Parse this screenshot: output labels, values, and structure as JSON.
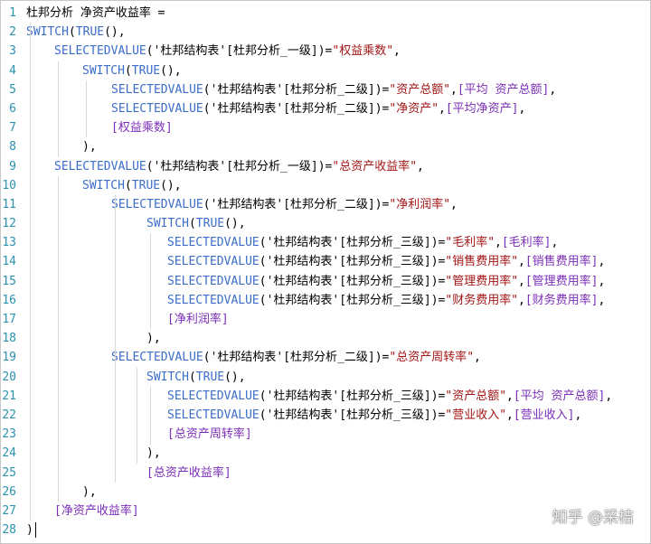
{
  "editor": {
    "lines": [
      {
        "n": "1",
        "indent": 0,
        "tokens": [
          {
            "t": "pl",
            "v": "杜邦分析 净资产收益率 ="
          }
        ]
      },
      {
        "n": "2",
        "indent": 0,
        "tokens": [
          {
            "t": "fn",
            "v": "SWITCH"
          },
          {
            "t": "pl",
            "v": "("
          },
          {
            "t": "fn",
            "v": "TRUE"
          },
          {
            "t": "pl",
            "v": "(),"
          }
        ]
      },
      {
        "n": "3",
        "indent": 1,
        "tokens": [
          {
            "t": "fn",
            "v": "SELECTEDVALUE"
          },
          {
            "t": "pl",
            "v": "('杜邦结构表'[杜邦分析_一级])="
          },
          {
            "t": "str",
            "v": "\"权益乘数\""
          },
          {
            "t": "pl",
            "v": ","
          }
        ]
      },
      {
        "n": "4",
        "indent": 2,
        "tokens": [
          {
            "t": "fn",
            "v": "SWITCH"
          },
          {
            "t": "pl",
            "v": "("
          },
          {
            "t": "fn",
            "v": "TRUE"
          },
          {
            "t": "pl",
            "v": "(),"
          }
        ]
      },
      {
        "n": "5",
        "indent": 3,
        "tokens": [
          {
            "t": "fn",
            "v": "SELECTEDVALUE"
          },
          {
            "t": "pl",
            "v": "('杜邦结构表'[杜邦分析_二级])="
          },
          {
            "t": "str",
            "v": "\"资产总额\""
          },
          {
            "t": "pl",
            "v": ","
          },
          {
            "t": "col",
            "v": "[平均 资产总额]"
          },
          {
            "t": "pl",
            "v": ","
          }
        ]
      },
      {
        "n": "6",
        "indent": 3,
        "tokens": [
          {
            "t": "fn",
            "v": "SELECTEDVALUE"
          },
          {
            "t": "pl",
            "v": "('杜邦结构表'[杜邦分析_二级])="
          },
          {
            "t": "str",
            "v": "\"净资产\""
          },
          {
            "t": "pl",
            "v": ","
          },
          {
            "t": "col",
            "v": "[平均净资产]"
          },
          {
            "t": "pl",
            "v": ","
          }
        ]
      },
      {
        "n": "7",
        "indent": 3,
        "tokens": [
          {
            "t": "col",
            "v": "[权益乘数]"
          }
        ]
      },
      {
        "n": "8",
        "indent": 2,
        "tokens": [
          {
            "t": "pl",
            "v": "),"
          }
        ]
      },
      {
        "n": "9",
        "indent": 1,
        "tokens": [
          {
            "t": "fn",
            "v": "SELECTEDVALUE"
          },
          {
            "t": "pl",
            "v": "('杜邦结构表'[杜邦分析_一级])="
          },
          {
            "t": "str",
            "v": "\"总资产收益率\""
          },
          {
            "t": "pl",
            "v": ","
          }
        ]
      },
      {
        "n": "10",
        "indent": 2,
        "tokens": [
          {
            "t": "fn",
            "v": "SWITCH"
          },
          {
            "t": "pl",
            "v": "("
          },
          {
            "t": "fn",
            "v": "TRUE"
          },
          {
            "t": "pl",
            "v": "(),"
          }
        ]
      },
      {
        "n": "11",
        "indent": 3,
        "tokens": [
          {
            "t": "fn",
            "v": "SELECTEDVALUE"
          },
          {
            "t": "pl",
            "v": "('杜邦结构表'[杜邦分析_二级])="
          },
          {
            "t": "str",
            "v": "\"净利润率\""
          },
          {
            "t": "pl",
            "v": ","
          }
        ]
      },
      {
        "n": "12",
        "indent": 4,
        "tokens": [
          {
            "t": "fn",
            "v": "SWITCH"
          },
          {
            "t": "pl",
            "v": "("
          },
          {
            "t": "fn",
            "v": "TRUE"
          },
          {
            "t": "pl",
            "v": "(),"
          }
        ]
      },
      {
        "n": "13",
        "indent": 5,
        "tokens": [
          {
            "t": "fn",
            "v": "SELECTEDVALUE"
          },
          {
            "t": "pl",
            "v": "('杜邦结构表'[杜邦分析_三级])="
          },
          {
            "t": "str",
            "v": "\"毛利率\""
          },
          {
            "t": "pl",
            "v": ","
          },
          {
            "t": "col",
            "v": "[毛利率]"
          },
          {
            "t": "pl",
            "v": ","
          }
        ]
      },
      {
        "n": "14",
        "indent": 5,
        "tokens": [
          {
            "t": "fn",
            "v": "SELECTEDVALUE"
          },
          {
            "t": "pl",
            "v": "('杜邦结构表'[杜邦分析_三级])="
          },
          {
            "t": "str",
            "v": "\"销售费用率\""
          },
          {
            "t": "pl",
            "v": ","
          },
          {
            "t": "col",
            "v": "[销售费用率]"
          },
          {
            "t": "pl",
            "v": ","
          }
        ]
      },
      {
        "n": "15",
        "indent": 5,
        "tokens": [
          {
            "t": "fn",
            "v": "SELECTEDVALUE"
          },
          {
            "t": "pl",
            "v": "('杜邦结构表'[杜邦分析_三级])="
          },
          {
            "t": "str",
            "v": "\"管理费用率\""
          },
          {
            "t": "pl",
            "v": ","
          },
          {
            "t": "col",
            "v": "[管理费用率]"
          },
          {
            "t": "pl",
            "v": ","
          }
        ]
      },
      {
        "n": "16",
        "indent": 5,
        "tokens": [
          {
            "t": "fn",
            "v": "SELECTEDVALUE"
          },
          {
            "t": "pl",
            "v": "('杜邦结构表'[杜邦分析_三级])="
          },
          {
            "t": "str",
            "v": "\"财务费用率\""
          },
          {
            "t": "pl",
            "v": ","
          },
          {
            "t": "col",
            "v": "[财务费用率]"
          },
          {
            "t": "pl",
            "v": ","
          }
        ]
      },
      {
        "n": "17",
        "indent": 5,
        "tokens": [
          {
            "t": "col",
            "v": "[净利润率]"
          }
        ]
      },
      {
        "n": "18",
        "indent": 4,
        "tokens": [
          {
            "t": "pl",
            "v": "),"
          }
        ]
      },
      {
        "n": "19",
        "indent": 3,
        "tokens": [
          {
            "t": "fn",
            "v": "SELECTEDVALUE"
          },
          {
            "t": "pl",
            "v": "('杜邦结构表'[杜邦分析_二级])="
          },
          {
            "t": "str",
            "v": "\"总资产周转率\""
          },
          {
            "t": "pl",
            "v": ","
          }
        ]
      },
      {
        "n": "20",
        "indent": 4,
        "tokens": [
          {
            "t": "fn",
            "v": "SWITCH"
          },
          {
            "t": "pl",
            "v": "("
          },
          {
            "t": "fn",
            "v": "TRUE"
          },
          {
            "t": "pl",
            "v": "(),"
          }
        ]
      },
      {
        "n": "21",
        "indent": 5,
        "tokens": [
          {
            "t": "fn",
            "v": "SELECTEDVALUE"
          },
          {
            "t": "pl",
            "v": "('杜邦结构表'[杜邦分析_三级])="
          },
          {
            "t": "str",
            "v": "\"资产总额\""
          },
          {
            "t": "pl",
            "v": ","
          },
          {
            "t": "col",
            "v": "[平均 资产总额]"
          },
          {
            "t": "pl",
            "v": ","
          }
        ]
      },
      {
        "n": "22",
        "indent": 5,
        "tokens": [
          {
            "t": "fn",
            "v": "SELECTEDVALUE"
          },
          {
            "t": "pl",
            "v": "('杜邦结构表'[杜邦分析_三级])="
          },
          {
            "t": "str",
            "v": "\"营业收入\""
          },
          {
            "t": "pl",
            "v": ","
          },
          {
            "t": "col",
            "v": "[营业收入]"
          },
          {
            "t": "pl",
            "v": ","
          }
        ]
      },
      {
        "n": "23",
        "indent": 5,
        "tokens": [
          {
            "t": "col",
            "v": "[总资产周转率]"
          }
        ]
      },
      {
        "n": "24",
        "indent": 4,
        "tokens": [
          {
            "t": "pl",
            "v": "),"
          }
        ]
      },
      {
        "n": "25",
        "indent": 4,
        "tokens": [
          {
            "t": "col",
            "v": "[总资产收益率]"
          }
        ]
      },
      {
        "n": "26",
        "indent": 2,
        "tokens": [
          {
            "t": "pl",
            "v": "),"
          }
        ]
      },
      {
        "n": "27",
        "indent": 1,
        "tokens": [
          {
            "t": "col",
            "v": "[净资产收益率]"
          }
        ]
      },
      {
        "n": "28",
        "indent": 0,
        "tokens": [
          {
            "t": "pl",
            "v": ")"
          }
        ]
      }
    ]
  },
  "colors": {
    "function": "#3c6ec9",
    "string": "#a31515",
    "column": "#7b2fb8",
    "line_number": "#2b91af"
  },
  "watermark": {
    "text": "知乎 @采桔",
    "icon": "wechat-icon"
  }
}
